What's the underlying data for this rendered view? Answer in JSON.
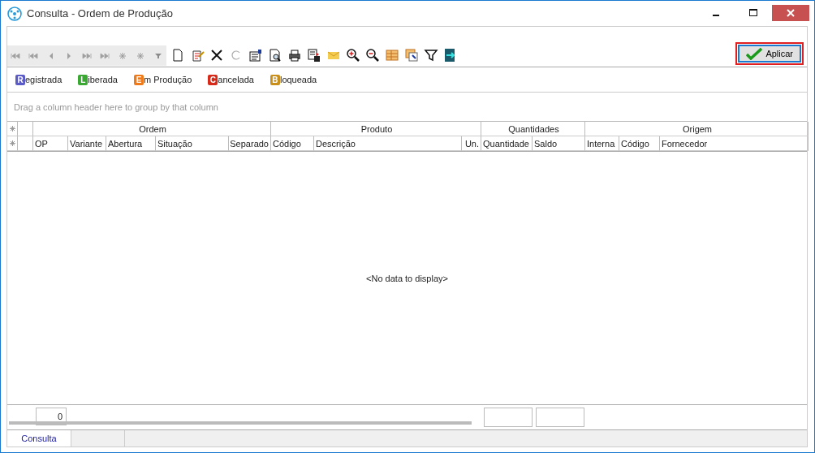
{
  "window": {
    "title": "Consulta - Ordem de Produção"
  },
  "apply_button": {
    "label": "Aplicar"
  },
  "legend": [
    {
      "letter": "R",
      "text": "egistrada",
      "color": "#5b5bc8"
    },
    {
      "letter": "L",
      "text": "iberada",
      "color": "#3aa832"
    },
    {
      "letter": "E",
      "text": "m Produção",
      "color": "#ee7a1a"
    },
    {
      "letter": "C",
      "text": "ancelada",
      "color": "#d62a1a"
    },
    {
      "letter": "B",
      "text": "loqueada",
      "color": "#c8901a"
    }
  ],
  "group_panel": {
    "placeholder": "Drag a column header here to group by that column"
  },
  "table": {
    "bands": [
      {
        "label": "Ordem"
      },
      {
        "label": "Produto"
      },
      {
        "label": "Quantidades"
      },
      {
        "label": "Origem"
      }
    ],
    "columns": [
      "OP",
      "Variante",
      "Abertura",
      "Situação",
      "Separado",
      "Código",
      "Descrição",
      "Un.",
      "Quantidade",
      "Saldo",
      "Interna",
      "Código",
      "Fornecedor"
    ],
    "empty_text": "<No data to display>"
  },
  "footer": {
    "summary": "0"
  },
  "tabs": [
    {
      "label": "Consulta",
      "selected": true
    }
  ]
}
